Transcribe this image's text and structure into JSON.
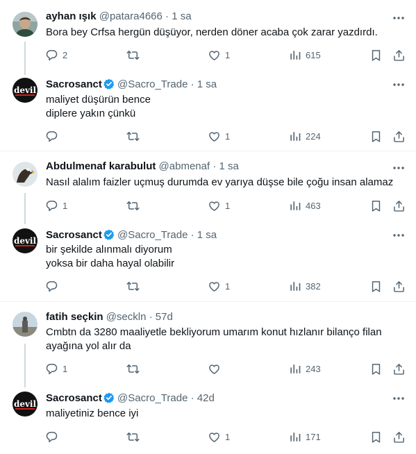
{
  "tweets": [
    {
      "name": "ayhan ışık",
      "handle": "@patara4666",
      "dot": "·",
      "time": "1 sa",
      "verified": false,
      "lines": [
        "Bora bey Crfsa hergün düşüyor, nerden döner acaba çok zarar yazdırdı."
      ],
      "replies": "2",
      "reposts": "",
      "likes": "1",
      "views": "615",
      "avatar": "photo-man"
    },
    {
      "name": "Sacrosanct",
      "handle": "@Sacro_Trade",
      "dot": "·",
      "time": "1 sa",
      "verified": true,
      "lines": [
        "maliyet düşürün bence",
        "diplere yakın çünkü"
      ],
      "replies": "",
      "reposts": "",
      "likes": "1",
      "views": "224",
      "avatar": "devil-logo"
    },
    {
      "name": "Abdulmenaf karabulut",
      "handle": "@abmenaf",
      "dot": "·",
      "time": "1 sa",
      "verified": false,
      "lines": [
        "Nasıl alalım faizler uçmuş durumda ev yarıya düşse bile çoğu insan alamaz"
      ],
      "replies": "1",
      "reposts": "",
      "likes": "1",
      "views": "463",
      "avatar": "eagle"
    },
    {
      "name": "Sacrosanct",
      "handle": "@Sacro_Trade",
      "dot": "·",
      "time": "1 sa",
      "verified": true,
      "lines": [
        "bir şekilde alınmalı diyorum",
        "yoksa bir daha hayal olabilir"
      ],
      "replies": "",
      "reposts": "",
      "likes": "1",
      "views": "382",
      "avatar": "devil-logo"
    },
    {
      "name": "fatih seçkin",
      "handle": "@seckln",
      "dot": "·",
      "time": "57d",
      "verified": false,
      "lines": [
        "Cmbtn da 3280 maaliyetle bekliyorum umarım konut hızlanır bilanço filan",
        "ayağına yol alır da"
      ],
      "replies": "1",
      "reposts": "",
      "likes": "",
      "views": "243",
      "avatar": "photo-statue"
    },
    {
      "name": "Sacrosanct",
      "handle": "@Sacro_Trade",
      "dot": "·",
      "time": "42d",
      "verified": true,
      "lines": [
        "maliyetiniz bence iyi"
      ],
      "replies": "",
      "reposts": "",
      "likes": "1",
      "views": "171",
      "avatar": "devil-logo"
    }
  ],
  "icons": {
    "reply": "reply-icon",
    "repost": "repost-icon",
    "like": "like-icon",
    "views": "views-icon",
    "bookmark": "bookmark-icon",
    "share": "share-icon",
    "more": "more-icon",
    "verified": "verified-badge-icon"
  },
  "colors": {
    "text": "#0f1419",
    "muted": "#536471",
    "verified": "#1d9bf0",
    "line": "#cfd9de",
    "divider": "#eff3f4"
  },
  "logo_text": "devil"
}
